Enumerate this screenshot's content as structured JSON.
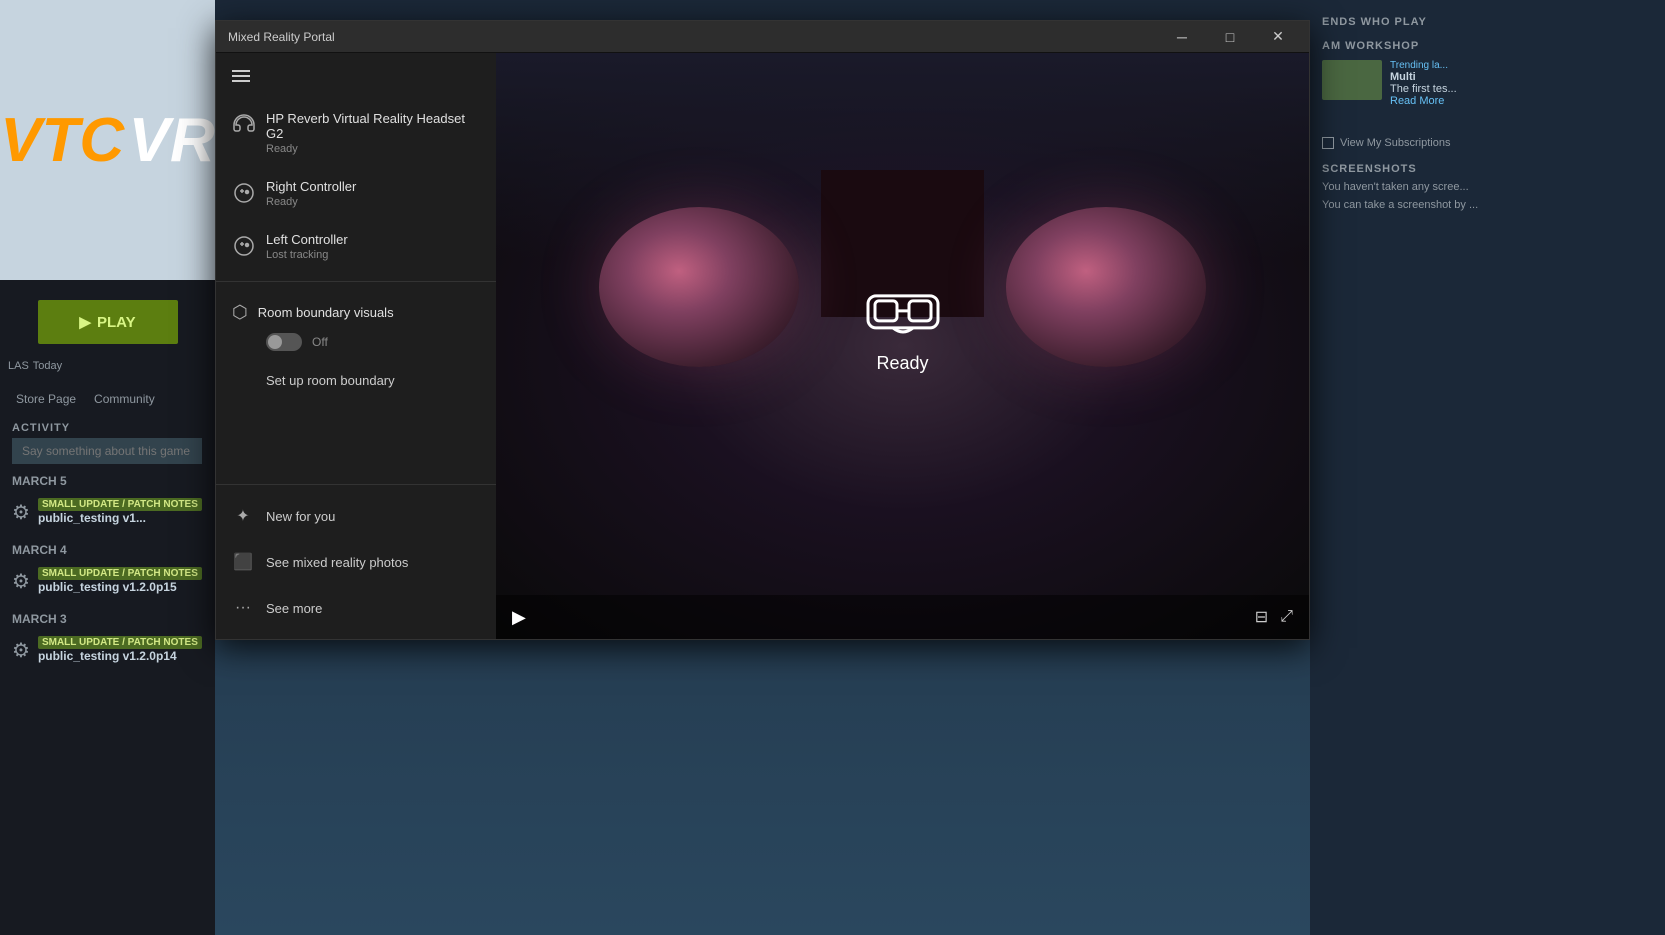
{
  "window": {
    "title": "Mixed Reality Portal",
    "min_btn": "─",
    "max_btn": "□",
    "close_btn": "✕"
  },
  "sidebar": {
    "devices": [
      {
        "name": "HP Reverb Virtual Reality Headset G2",
        "status": "Ready",
        "icon": "headset"
      },
      {
        "name": "Right Controller",
        "status": "Ready",
        "icon": "controller"
      },
      {
        "name": "Left Controller",
        "status": "Lost tracking",
        "icon": "controller"
      }
    ],
    "room_boundary": {
      "title": "Room boundary visuals",
      "toggle_state": "Off"
    },
    "setup_link": "Set up room boundary"
  },
  "menu_items": [
    {
      "label": "New for you",
      "icon": "star"
    },
    {
      "label": "See mixed reality photos",
      "icon": "photo"
    },
    {
      "label": "See more",
      "icon": "dots"
    }
  ],
  "main": {
    "status_text": "Ready",
    "play_btn": "▶"
  },
  "steam": {
    "left": {
      "logo_top": "VTC",
      "logo_bottom": "VR",
      "play_label": "PLAY",
      "last_played_label": "LAS",
      "today_label": "Today",
      "tabs": [
        "Store Page",
        "Community"
      ],
      "activity_label": "ACTIVITY",
      "activity_placeholder": "Say something about this game",
      "updates": [
        {
          "date": "MARCH 5",
          "badge": "SMALL UPDATE / PATCH NOTES",
          "title": "public_testing v1..."
        },
        {
          "date": "MARCH 4",
          "badge": "SMALL UPDATE / PATCH NOTES",
          "title": "public_testing v1.2.0p15"
        },
        {
          "date": "MARCH 3",
          "badge": "SMALL UPDATE / PATCH NOTES",
          "title": "public_testing v1.2.0p14"
        }
      ]
    },
    "right": {
      "friends_title": "ENDS WHO PLAY",
      "workshop_title": "AM WORKSHOP",
      "trending_badge": "Trending la...",
      "workshop_item_title": "Multi",
      "workshop_item_desc": "The first tes...",
      "read_more": "Read More",
      "screenshots_title": "SCREENSHOTS",
      "screenshots_empty1": "You haven't taken any scree...",
      "screenshots_empty2": "You can take a screenshot by ...",
      "view_subs": "View My Subscriptions"
    }
  }
}
